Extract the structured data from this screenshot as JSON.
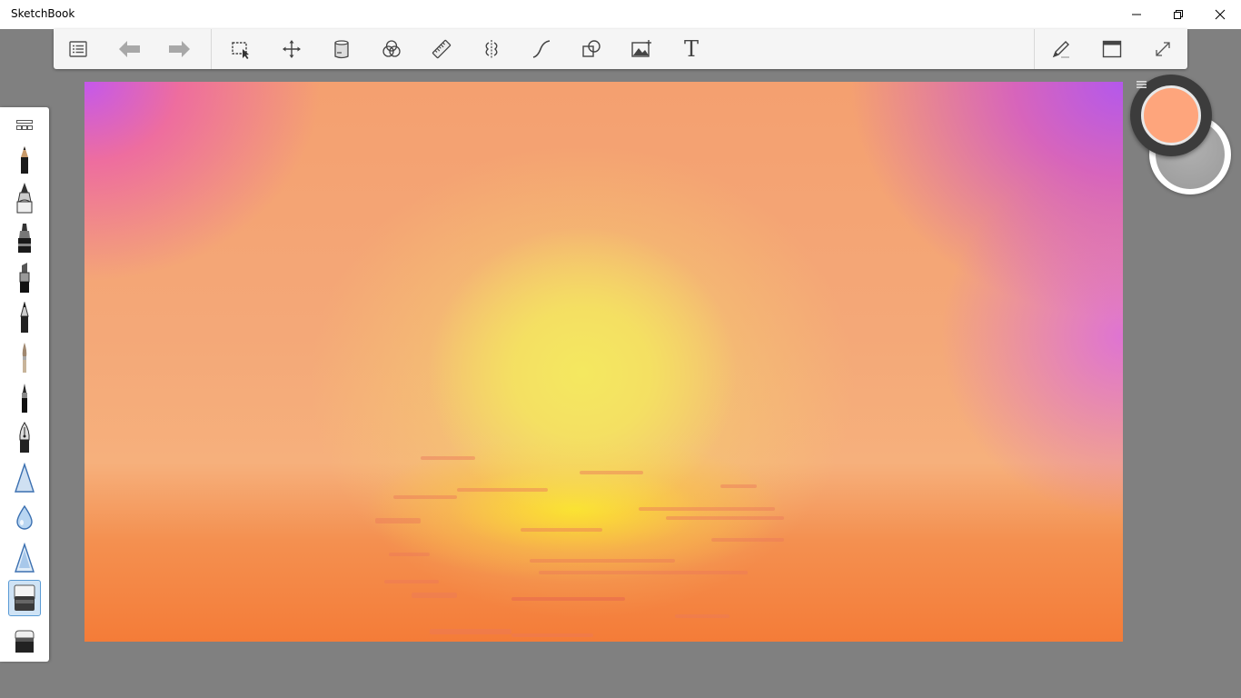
{
  "window": {
    "title": "SketchBook",
    "controls": [
      "minimize-icon",
      "restore-icon",
      "close-icon"
    ]
  },
  "toolbar": {
    "left_tools": [
      "list-icon",
      "undo-icon",
      "redo-icon"
    ],
    "main_tools": [
      "select-icon",
      "move-transform-icon",
      "layer-icon",
      "color-blend-icon",
      "ruler-icon",
      "symmetry-icon",
      "curve-icon",
      "shape-icon",
      "image-icon",
      "text-icon"
    ],
    "right_tools": [
      "brush-properties-icon",
      "window-icon",
      "fullscreen-icon"
    ],
    "text_glyph": "T"
  },
  "brush_palette": {
    "items": [
      "brush-library-icon",
      "pencil-icon",
      "ink-pen-icon",
      "marker-icon",
      "chisel-marker-icon",
      "fine-pen-icon",
      "paint-brush-icon",
      "ballpoint-icon",
      "fountain-pen-icon",
      "airbrush-icon",
      "water-drop-icon",
      "soft-cone-icon",
      "eraser-soft-icon",
      "eraser-hard-icon"
    ],
    "active": "eraser-soft-icon"
  },
  "color_puck": {
    "primary_color": "#fea57c",
    "secondary_color": "#a8a8a8",
    "menu_icon": "puck-menu-icon"
  },
  "canvas": {
    "description_colors": [
      "#c458ec",
      "#f4a070",
      "#f4e460",
      "#f47c38"
    ]
  }
}
